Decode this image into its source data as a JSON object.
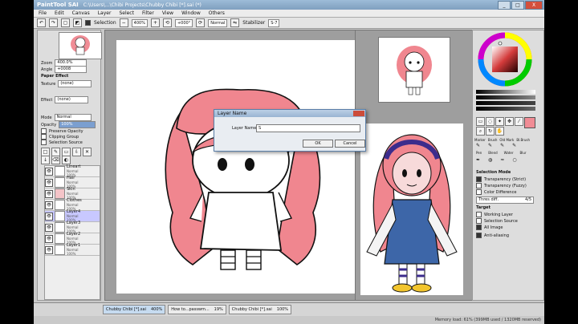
{
  "window": {
    "logo": "PaintTool SAI",
    "title": "C:\\Users\\...\\Chibi Projects\\Chubby Chibi [*].sai (*)",
    "min_label": "_",
    "max_label": "□",
    "close_label": "X"
  },
  "menu": [
    "File",
    "Edit",
    "Canvas",
    "Layer",
    "Select",
    "Filter",
    "View",
    "Window",
    "Others"
  ],
  "toolbar": {
    "selection_label": "Selection",
    "zoom": "400%",
    "angle": "+000°",
    "blend": "Normal",
    "stabilizer_label": "Stabilizer",
    "stabilizer": "S-7"
  },
  "navigator": {
    "zoom_label": "Zoom",
    "zoom": "400.0%",
    "angle_label": "Angle",
    "angle": "+0008"
  },
  "paper_effect": {
    "header": "Paper Effect",
    "texture_label": "Texture",
    "texture": "(none)",
    "effect_label": "Effect",
    "effect": "(none)"
  },
  "layer_props": {
    "mode_label": "Mode",
    "mode": "Normal",
    "opacity_label": "Opacity",
    "opacity": "100%",
    "preserve_opacity": "Preserve Opacity",
    "clipping_group": "Clipping Group",
    "selection_source": "Selection Source"
  },
  "layers": [
    {
      "name": "Lineart",
      "mode": "Normal",
      "opacity": "100%"
    },
    {
      "name": "Hair",
      "mode": "Normal",
      "opacity": "100%"
    },
    {
      "name": "Skin",
      "mode": "Normal",
      "opacity": "100%"
    },
    {
      "name": "Clothes",
      "mode": "Normal",
      "opacity": "100%"
    },
    {
      "name": "Layer4",
      "mode": "Normal",
      "opacity": "100%"
    },
    {
      "name": "Layer3",
      "mode": "Normal",
      "opacity": "100%"
    },
    {
      "name": "Layer2",
      "mode": "Normal",
      "opacity": "100%"
    },
    {
      "name": "Layer1",
      "mode": "Normal",
      "opacity": "100%"
    }
  ],
  "dialog": {
    "title": "Layer Name",
    "name_label": "Layer Name:",
    "name_value": "S",
    "ok": "OK",
    "cancel": "Cancel"
  },
  "tools": {
    "row1": [
      "Marker",
      "Brush",
      "Old Mark",
      "Bl.Brush"
    ],
    "row2": [
      "Pen",
      "Blend",
      "Water",
      "Blur"
    ]
  },
  "selection_mode": {
    "header": "Selection Mode",
    "transparency_strict": "Transparency (Strict)",
    "transparency_fuzzy": "Transparency (Fuzzy)",
    "color_difference": "Color Difference",
    "threshold_label": "Thres diff.",
    "threshold": "4/5"
  },
  "target": {
    "header": "Target",
    "working_layer": "Working Layer",
    "selection_source": "Selection Source",
    "all_image": "All Image",
    "anti_aliasing": "Anti-aliasing"
  },
  "taskbar": [
    {
      "name": "Chubby Chibi [*].sai",
      "zoom": "400%"
    },
    {
      "name": "How to...passwm...",
      "zoom": "19%"
    },
    {
      "name": "Chubby Chibi [*].sai",
      "zoom": "100%"
    }
  ],
  "memory": "Memory load: 61% (399MB used / 1320MB reserved)"
}
